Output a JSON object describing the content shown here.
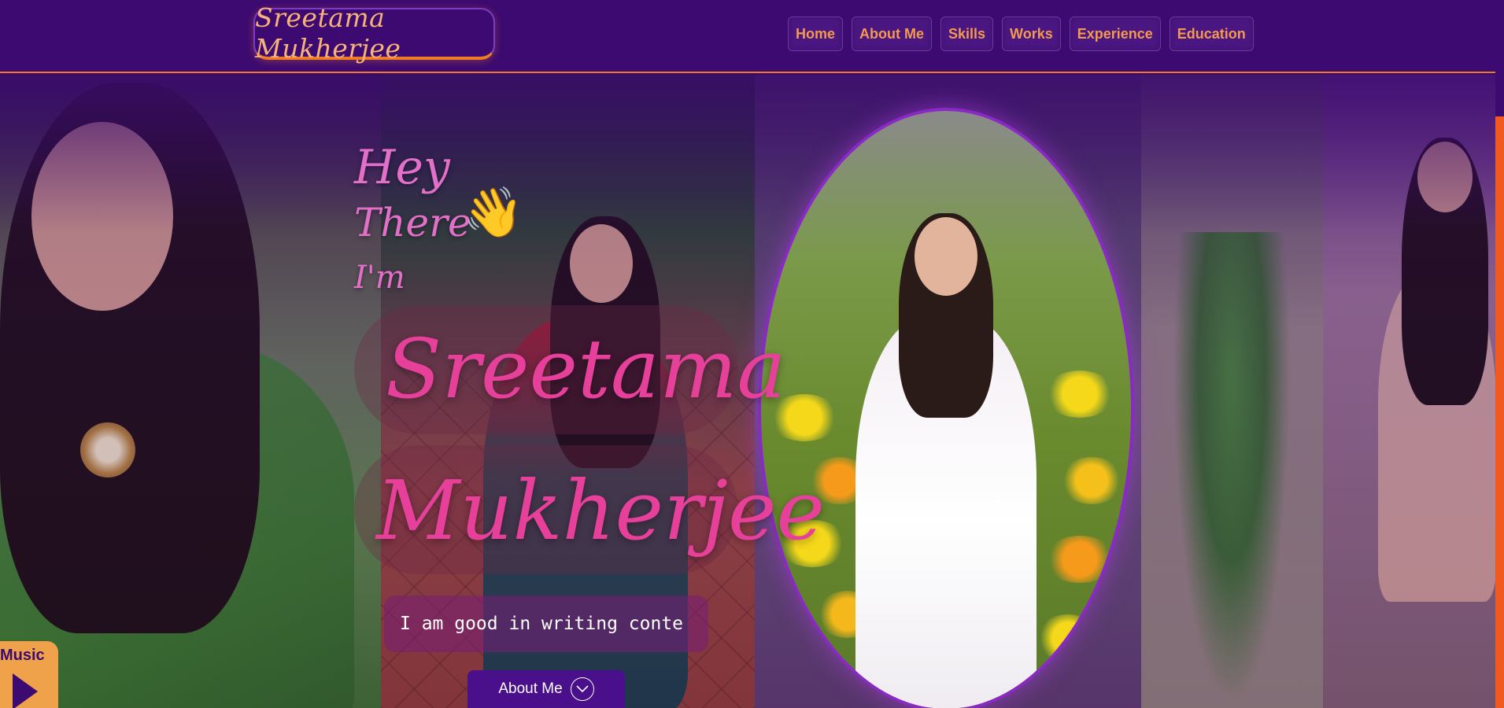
{
  "navbar": {
    "logo": "Sreetama Mukherjee",
    "links": [
      {
        "label": "Home"
      },
      {
        "label": "About Me"
      },
      {
        "label": "Skills"
      },
      {
        "label": "Works"
      },
      {
        "label": "Experience"
      },
      {
        "label": "Education"
      }
    ]
  },
  "hero": {
    "greeting_line1": "Hey",
    "greeting_line2": "There",
    "greeting_line3": "I'm",
    "wave_icon": "👋",
    "first_name": "Sreetama",
    "last_name": "Mukherjee",
    "typing_text": "I am good in writing conte",
    "about_button": "About Me",
    "about_button_icon": "∨"
  },
  "music": {
    "label": "Music"
  },
  "colors": {
    "background": "#3c0a70",
    "accent_orange": "#f07b26",
    "name_pink": "#e6409a",
    "greeting_pink": "#e270c8"
  }
}
